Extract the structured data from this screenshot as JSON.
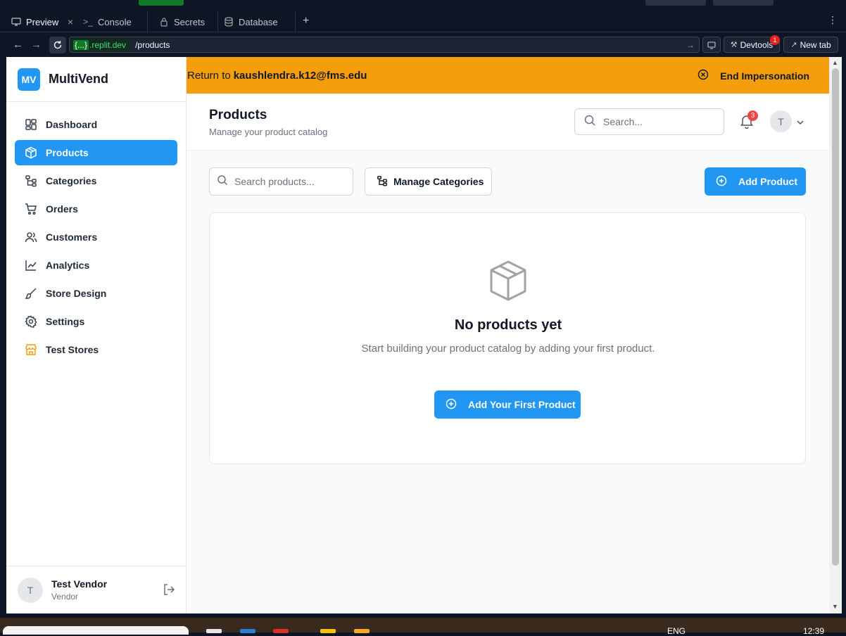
{
  "browser": {
    "tabs": [
      {
        "label": "Preview",
        "icon": "monitor-icon",
        "active": true
      },
      {
        "label": "Console",
        "icon": "terminal-icon"
      },
      {
        "label": "Secrets",
        "icon": "lock-icon"
      },
      {
        "label": "Database",
        "icon": "database-icon"
      }
    ],
    "url_domain_braces": "{...}",
    "url_domain": ".replit.dev",
    "url_path": "/products",
    "devtools_label": "Devtools",
    "devtools_badge": "1",
    "newtab_label": "New tab"
  },
  "app": {
    "logo": "MV",
    "name": "MultiVend",
    "menu": [
      {
        "label": "Dashboard",
        "icon": "dashboard-icon"
      },
      {
        "label": "Products",
        "icon": "box-icon",
        "active": true
      },
      {
        "label": "Categories",
        "icon": "category-tree-icon"
      },
      {
        "label": "Orders",
        "icon": "cart-icon"
      },
      {
        "label": "Customers",
        "icon": "users-icon"
      },
      {
        "label": "Analytics",
        "icon": "line-chart-icon"
      },
      {
        "label": "Store Design",
        "icon": "brush-icon"
      },
      {
        "label": "Settings",
        "icon": "gear-icon"
      },
      {
        "label": "Test Stores",
        "icon": "store-icon"
      }
    ],
    "user": {
      "initial": "T",
      "name": "Test Vendor",
      "role": "Vendor"
    }
  },
  "banner": {
    "prefix": "Return to",
    "email": "kaushlendra.k12@fms.edu",
    "end_label": "End Impersonation",
    "color": "#f59e0b"
  },
  "header": {
    "title": "Products",
    "subtitle": "Manage your product catalog",
    "search_placeholder": "Search...",
    "notifications": "3",
    "avatar_initial": "T"
  },
  "toolbar": {
    "search_placeholder": "Search products...",
    "manage_categories": "Manage Categories",
    "add_product": "Add Product"
  },
  "empty_state": {
    "title": "No products yet",
    "description": "Start building your product catalog by adding your first product.",
    "button": "Add Your First Product"
  },
  "taskbar": {
    "lang": "ENG",
    "time": "12:39"
  },
  "colors": {
    "accent": "#2196f3",
    "banner": "#f59e0b",
    "badge": "#ef4444"
  }
}
